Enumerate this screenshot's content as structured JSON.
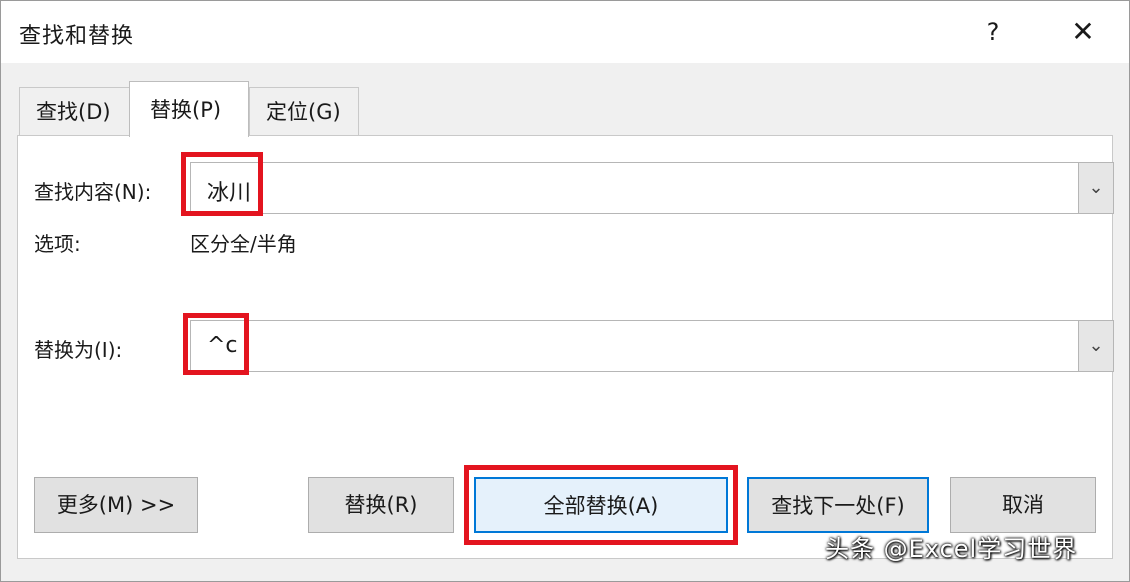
{
  "dialog": {
    "title": "查找和替换",
    "help": "?",
    "close": "✕"
  },
  "tabs": [
    {
      "label": "查找(D)"
    },
    {
      "label": "替换(P)"
    },
    {
      "label": "定位(G)"
    }
  ],
  "find": {
    "label": "查找内容(N):",
    "value": "冰川"
  },
  "options": {
    "label": "选项:",
    "value": "区分全/半角"
  },
  "replace": {
    "label": "替换为(I):",
    "value": "^c"
  },
  "buttons": {
    "more": "更多(M) >>",
    "replace": "替换(R)",
    "replace_all": "全部替换(A)",
    "find_next": "查找下一处(F)",
    "cancel": "取消"
  },
  "watermark": "头条 @Excel学习世界",
  "colors": {
    "highlight": "#e3141f",
    "focus": "#0078d7"
  }
}
